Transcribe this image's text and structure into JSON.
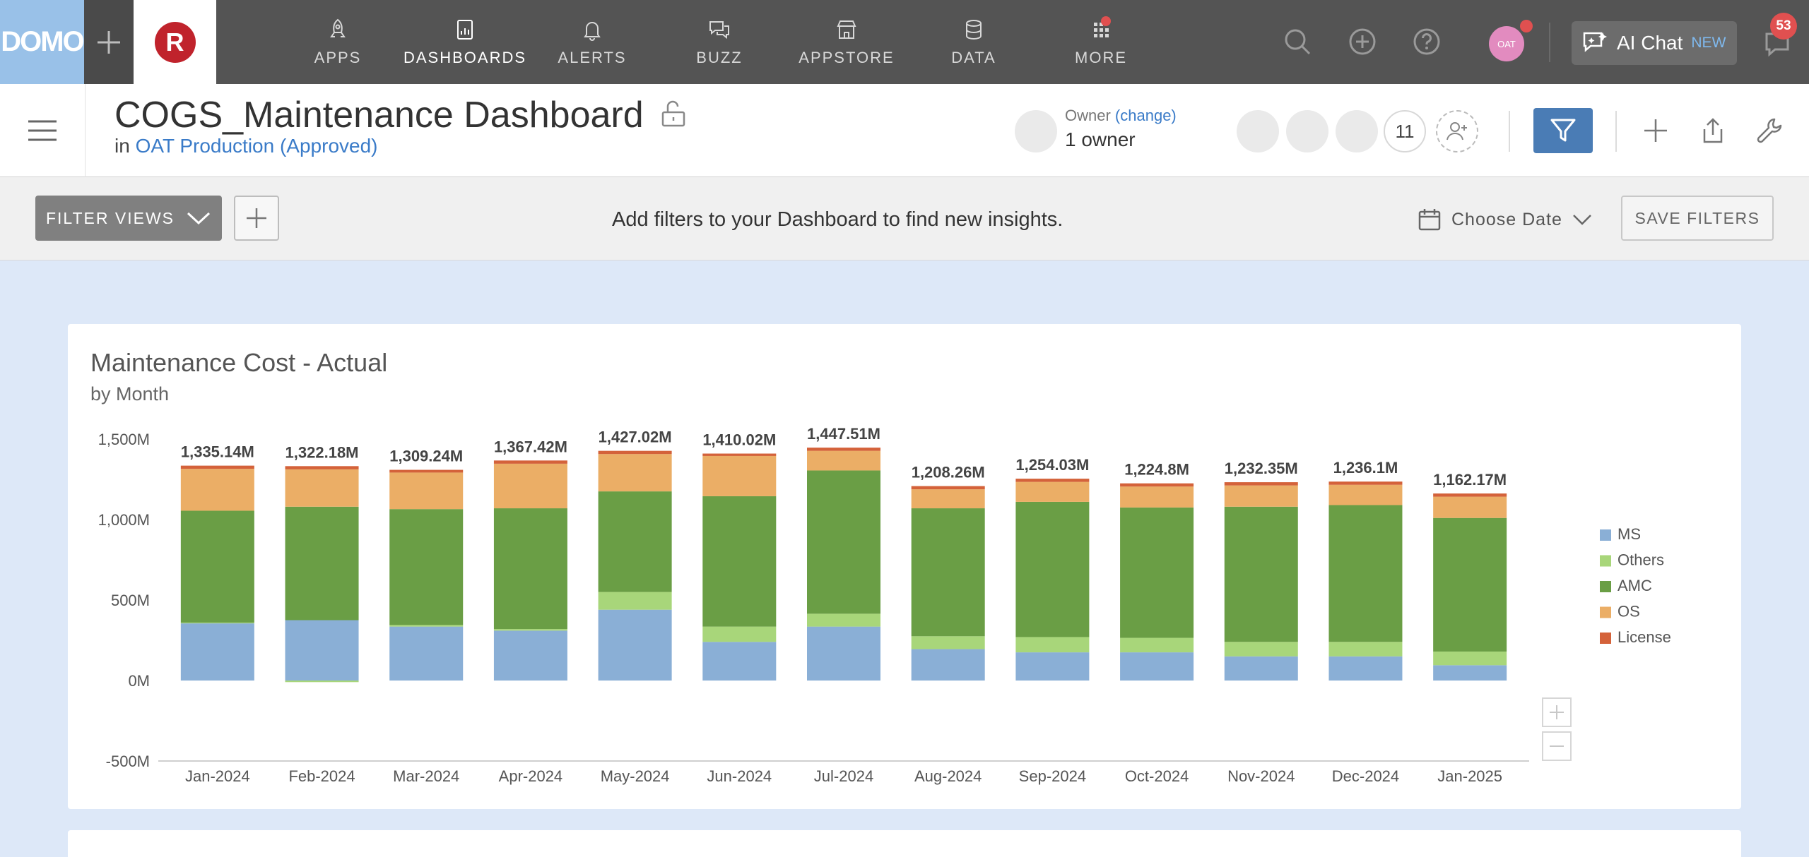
{
  "topbar": {
    "brand": "DOMO",
    "instance_logo": "R",
    "nav": [
      {
        "label": "APPS",
        "icon": "rocket-icon"
      },
      {
        "label": "DASHBOARDS",
        "icon": "dashboard-icon"
      },
      {
        "label": "ALERTS",
        "icon": "bell-icon"
      },
      {
        "label": "BUZZ",
        "icon": "chat-bubbles-icon"
      },
      {
        "label": "APPSTORE",
        "icon": "store-icon"
      },
      {
        "label": "DATA",
        "icon": "database-icon"
      },
      {
        "label": "MORE",
        "icon": "grid-icon"
      }
    ],
    "active_nav": "DASHBOARDS",
    "user_initials": "OAT",
    "ai_chat_label": "AI Chat",
    "ai_chat_badge": "NEW",
    "notification_count": "53"
  },
  "header": {
    "title": "COGS_Maintenance Dashboard",
    "in_prefix": "in",
    "location_link": "OAT Production (Approved)",
    "owner_label": "Owner",
    "owner_change": "(change)",
    "owner_count": "1 owner",
    "shared_count": "11"
  },
  "filterbar": {
    "filter_views_label": "FILTER VIEWS",
    "message": "Add filters to your Dashboard to find new insights.",
    "choose_date_label": "Choose Date",
    "save_filters_label": "SAVE FILTERS"
  },
  "card": {
    "title": "Maintenance Cost - Actual",
    "subtitle": "by Month"
  },
  "colors": {
    "MS": "#8aafd6",
    "Others": "#a8d67a",
    "AMC": "#6a9e45",
    "OS": "#ebae66",
    "License": "#d4623a"
  },
  "chart_data": {
    "type": "bar",
    "stacked": true,
    "title": "Maintenance Cost - Actual",
    "subtitle": "by Month",
    "xlabel": "",
    "ylabel": "",
    "ylim": [
      -500,
      1500
    ],
    "yticks": [
      "1,500M",
      "1,000M",
      "500M",
      "0M",
      "-500M"
    ],
    "ytick_values": [
      1500,
      1000,
      500,
      0,
      -500
    ],
    "categories": [
      "Jan-2024",
      "Feb-2024",
      "Mar-2024",
      "Apr-2024",
      "May-2024",
      "Jun-2024",
      "Jul-2024",
      "Aug-2024",
      "Sep-2024",
      "Oct-2024",
      "Nov-2024",
      "Dec-2024",
      "Jan-2025"
    ],
    "totals_labels": [
      "1,335.14M",
      "1,322.18M",
      "1,309.24M",
      "1,367.42M",
      "1,427.02M",
      "1,410.02M",
      "1,447.51M",
      "1,208.26M",
      "1,254.03M",
      "1,224.8M",
      "1,232.35M",
      "1,236.1M",
      "1,162.17M"
    ],
    "legend_position": "right",
    "series": [
      {
        "name": "MS",
        "values": [
          355,
          375,
          335,
          310,
          440,
          240,
          335,
          195,
          175,
          175,
          150,
          150,
          95
        ]
      },
      {
        "name": "Others",
        "values": [
          5,
          -10,
          10,
          10,
          110,
          95,
          80,
          80,
          95,
          90,
          90,
          90,
          85
        ]
      },
      {
        "name": "AMC",
        "values": [
          695,
          705,
          720,
          750,
          625,
          810,
          890,
          795,
          840,
          810,
          840,
          850,
          830
        ]
      },
      {
        "name": "OS",
        "values": [
          260,
          232,
          227,
          277,
          232,
          250,
          122,
          118,
          124,
          130,
          132,
          126,
          132
        ]
      },
      {
        "name": "License",
        "values": [
          20,
          20,
          17,
          20,
          20,
          15,
          20,
          20,
          20,
          20,
          20,
          20,
          20
        ]
      }
    ]
  }
}
